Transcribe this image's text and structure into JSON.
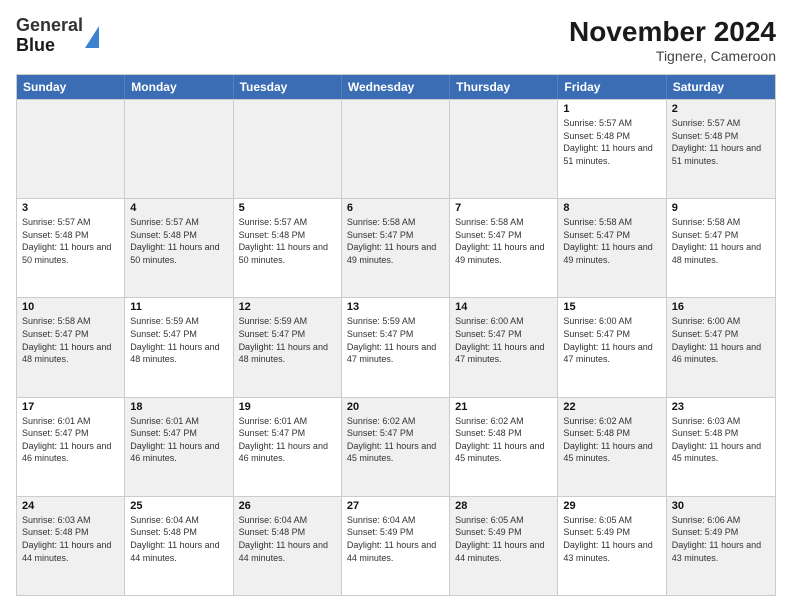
{
  "logo": {
    "line1": "General",
    "line2": "Blue"
  },
  "header": {
    "month": "November 2024",
    "location": "Tignere, Cameroon"
  },
  "weekdays": [
    "Sunday",
    "Monday",
    "Tuesday",
    "Wednesday",
    "Thursday",
    "Friday",
    "Saturday"
  ],
  "rows": [
    [
      {
        "day": "",
        "info": "",
        "shaded": true
      },
      {
        "day": "",
        "info": "",
        "shaded": true
      },
      {
        "day": "",
        "info": "",
        "shaded": true
      },
      {
        "day": "",
        "info": "",
        "shaded": true
      },
      {
        "day": "",
        "info": "",
        "shaded": true
      },
      {
        "day": "1",
        "info": "Sunrise: 5:57 AM\nSunset: 5:48 PM\nDaylight: 11 hours and 51 minutes."
      },
      {
        "day": "2",
        "info": "Sunrise: 5:57 AM\nSunset: 5:48 PM\nDaylight: 11 hours and 51 minutes.",
        "shaded": true
      }
    ],
    [
      {
        "day": "3",
        "info": "Sunrise: 5:57 AM\nSunset: 5:48 PM\nDaylight: 11 hours and 50 minutes."
      },
      {
        "day": "4",
        "info": "Sunrise: 5:57 AM\nSunset: 5:48 PM\nDaylight: 11 hours and 50 minutes.",
        "shaded": true
      },
      {
        "day": "5",
        "info": "Sunrise: 5:57 AM\nSunset: 5:48 PM\nDaylight: 11 hours and 50 minutes."
      },
      {
        "day": "6",
        "info": "Sunrise: 5:58 AM\nSunset: 5:47 PM\nDaylight: 11 hours and 49 minutes.",
        "shaded": true
      },
      {
        "day": "7",
        "info": "Sunrise: 5:58 AM\nSunset: 5:47 PM\nDaylight: 11 hours and 49 minutes."
      },
      {
        "day": "8",
        "info": "Sunrise: 5:58 AM\nSunset: 5:47 PM\nDaylight: 11 hours and 49 minutes.",
        "shaded": true
      },
      {
        "day": "9",
        "info": "Sunrise: 5:58 AM\nSunset: 5:47 PM\nDaylight: 11 hours and 48 minutes."
      }
    ],
    [
      {
        "day": "10",
        "info": "Sunrise: 5:58 AM\nSunset: 5:47 PM\nDaylight: 11 hours and 48 minutes.",
        "shaded": true
      },
      {
        "day": "11",
        "info": "Sunrise: 5:59 AM\nSunset: 5:47 PM\nDaylight: 11 hours and 48 minutes."
      },
      {
        "day": "12",
        "info": "Sunrise: 5:59 AM\nSunset: 5:47 PM\nDaylight: 11 hours and 48 minutes.",
        "shaded": true
      },
      {
        "day": "13",
        "info": "Sunrise: 5:59 AM\nSunset: 5:47 PM\nDaylight: 11 hours and 47 minutes."
      },
      {
        "day": "14",
        "info": "Sunrise: 6:00 AM\nSunset: 5:47 PM\nDaylight: 11 hours and 47 minutes.",
        "shaded": true
      },
      {
        "day": "15",
        "info": "Sunrise: 6:00 AM\nSunset: 5:47 PM\nDaylight: 11 hours and 47 minutes."
      },
      {
        "day": "16",
        "info": "Sunrise: 6:00 AM\nSunset: 5:47 PM\nDaylight: 11 hours and 46 minutes.",
        "shaded": true
      }
    ],
    [
      {
        "day": "17",
        "info": "Sunrise: 6:01 AM\nSunset: 5:47 PM\nDaylight: 11 hours and 46 minutes."
      },
      {
        "day": "18",
        "info": "Sunrise: 6:01 AM\nSunset: 5:47 PM\nDaylight: 11 hours and 46 minutes.",
        "shaded": true
      },
      {
        "day": "19",
        "info": "Sunrise: 6:01 AM\nSunset: 5:47 PM\nDaylight: 11 hours and 46 minutes."
      },
      {
        "day": "20",
        "info": "Sunrise: 6:02 AM\nSunset: 5:47 PM\nDaylight: 11 hours and 45 minutes.",
        "shaded": true
      },
      {
        "day": "21",
        "info": "Sunrise: 6:02 AM\nSunset: 5:48 PM\nDaylight: 11 hours and 45 minutes."
      },
      {
        "day": "22",
        "info": "Sunrise: 6:02 AM\nSunset: 5:48 PM\nDaylight: 11 hours and 45 minutes.",
        "shaded": true
      },
      {
        "day": "23",
        "info": "Sunrise: 6:03 AM\nSunset: 5:48 PM\nDaylight: 11 hours and 45 minutes."
      }
    ],
    [
      {
        "day": "24",
        "info": "Sunrise: 6:03 AM\nSunset: 5:48 PM\nDaylight: 11 hours and 44 minutes.",
        "shaded": true
      },
      {
        "day": "25",
        "info": "Sunrise: 6:04 AM\nSunset: 5:48 PM\nDaylight: 11 hours and 44 minutes."
      },
      {
        "day": "26",
        "info": "Sunrise: 6:04 AM\nSunset: 5:48 PM\nDaylight: 11 hours and 44 minutes.",
        "shaded": true
      },
      {
        "day": "27",
        "info": "Sunrise: 6:04 AM\nSunset: 5:49 PM\nDaylight: 11 hours and 44 minutes."
      },
      {
        "day": "28",
        "info": "Sunrise: 6:05 AM\nSunset: 5:49 PM\nDaylight: 11 hours and 44 minutes.",
        "shaded": true
      },
      {
        "day": "29",
        "info": "Sunrise: 6:05 AM\nSunset: 5:49 PM\nDaylight: 11 hours and 43 minutes."
      },
      {
        "day": "30",
        "info": "Sunrise: 6:06 AM\nSunset: 5:49 PM\nDaylight: 11 hours and 43 minutes.",
        "shaded": true
      }
    ]
  ]
}
